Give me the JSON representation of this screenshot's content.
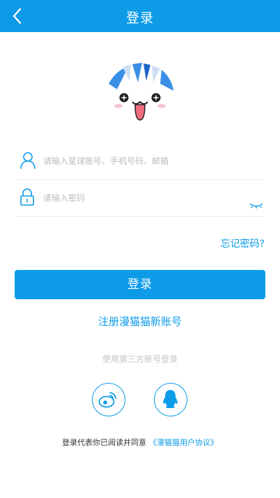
{
  "header": {
    "title": "登录",
    "back_icon": "chevron-left-icon",
    "color": "#0d9be8"
  },
  "form": {
    "username_placeholder": "请输入星球账号、手机号码、邮箱",
    "password_placeholder": "请输入密码",
    "user_icon": "user-icon",
    "lock_icon": "lock-icon",
    "toggle_icon": "closed-eye-icon"
  },
  "forgot_password": "忘记密码?",
  "login_button": "登录",
  "register_link": "注册漫猫猫新账号",
  "third_party": {
    "label": "使用第三方账号登录",
    "providers": [
      "weibo-icon",
      "qq-icon"
    ]
  },
  "agreement": {
    "text": "登录代表你已阅读并同意",
    "link": "《漫猫猫用户协议》"
  }
}
